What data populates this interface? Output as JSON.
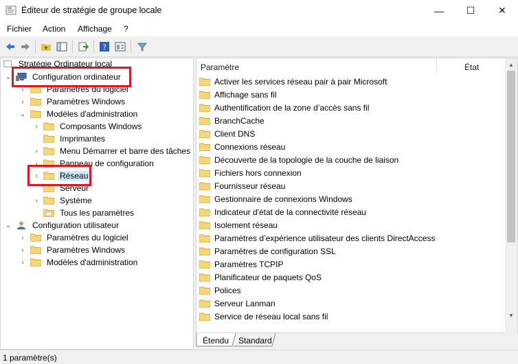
{
  "window": {
    "title": "Éditeur de stratégie de groupe locale",
    "minimize": "—",
    "maximize": "☐",
    "close": "✕"
  },
  "menu": {
    "items": [
      "Fichier",
      "Action",
      "Affichage",
      "?"
    ]
  },
  "toolbar": {
    "icons": [
      "back-arrow-icon",
      "forward-arrow-icon",
      "up-folder-icon",
      "show-hide-tree-icon",
      "export-list-icon",
      "help-icon",
      "properties-icon",
      "filter-icon"
    ]
  },
  "tree": {
    "root": "Stratégie Ordinateur local",
    "items": [
      {
        "label": "Configuration ordinateur"
      },
      {
        "label": "Paramètres du logiciel"
      },
      {
        "label": "Paramètres Windows"
      },
      {
        "label": "Modèles d'administration"
      },
      {
        "label": "Composants Windows"
      },
      {
        "label": "Imprimantes"
      },
      {
        "label": "Menu Démarrer et barre des tâches"
      },
      {
        "label": "Panneau de configuration"
      },
      {
        "label": "Réseau"
      },
      {
        "label": "Serveur"
      },
      {
        "label": "Système"
      },
      {
        "label": "Tous les paramètres"
      },
      {
        "label": "Configuration utilisateur"
      },
      {
        "label": "Paramètres du logiciel"
      },
      {
        "label": "Paramètres Windows"
      },
      {
        "label": "Modèles d'administration"
      }
    ]
  },
  "list": {
    "columns": [
      "Paramètre",
      "État"
    ],
    "rows": [
      "Activer les services réseau pair à pair Microsoft",
      "Affichage sans fil",
      "Authentification de la zone d’accès sans fil",
      "BranchCache",
      "Client DNS",
      "Connexions réseau",
      "Découverte de la topologie de la couche de liaison",
      "Fichiers hors connexion",
      "Fournisseur réseau",
      "Gestionnaire de connexions Windows",
      "Indicateur d'état de la connectivité réseau",
      "Isolement réseau",
      "Paramètres d’expérience utilisateur des clients DirectAccess",
      "Paramètres de configuration SSL",
      "Paramètres TCPIP",
      "Planificateur de paquets QoS",
      "Polices",
      "Serveur Lanman",
      "Service de réseau local sans fil"
    ]
  },
  "tabs": [
    "Étendu",
    "Standard"
  ],
  "status": {
    "text": "1 paramètre(s)"
  },
  "colors": {
    "highlight": "#e0151f",
    "selection": "#cce8ff",
    "folder": "#f6d67a"
  }
}
